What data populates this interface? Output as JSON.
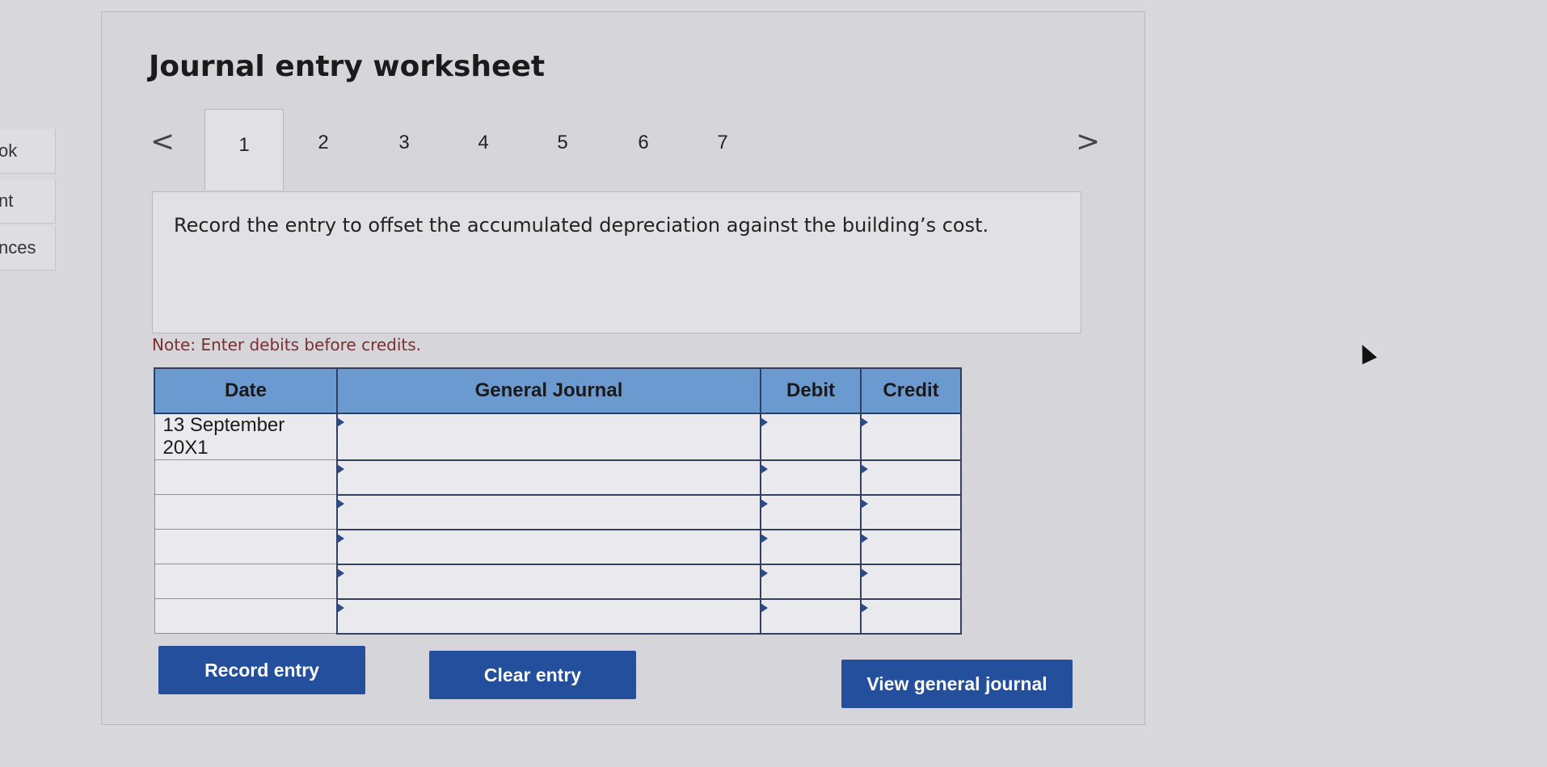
{
  "sidebar": {
    "items": [
      {
        "label": "ok"
      },
      {
        "label": "nt"
      },
      {
        "label": "nces"
      }
    ]
  },
  "worksheet": {
    "title": "Journal entry worksheet",
    "prev_arrow": "<",
    "next_arrow": ">",
    "tabs": [
      {
        "label": "1",
        "active": true
      },
      {
        "label": "2"
      },
      {
        "label": "3"
      },
      {
        "label": "4"
      },
      {
        "label": "5"
      },
      {
        "label": "6"
      },
      {
        "label": "7"
      }
    ],
    "prompt": "Record the entry to offset the accumulated depreciation against the building’s cost.",
    "note": "Note: Enter debits before credits.",
    "table": {
      "headers": [
        "Date",
        "General Journal",
        "Debit",
        "Credit"
      ],
      "rows": [
        {
          "date": "13 September 20X1",
          "account": "",
          "debit": "",
          "credit": ""
        },
        {
          "date": "",
          "account": "",
          "debit": "",
          "credit": ""
        },
        {
          "date": "",
          "account": "",
          "debit": "",
          "credit": ""
        },
        {
          "date": "",
          "account": "",
          "debit": "",
          "credit": ""
        },
        {
          "date": "",
          "account": "",
          "debit": "",
          "credit": ""
        },
        {
          "date": "",
          "account": "",
          "debit": "",
          "credit": ""
        }
      ]
    },
    "buttons": {
      "record": "Record entry",
      "clear": "Clear entry",
      "view": "View general journal"
    }
  },
  "colors": {
    "header_blue": "#6b9ad0",
    "button_blue": "#234f9c",
    "note_red": "#7b2f2f"
  }
}
